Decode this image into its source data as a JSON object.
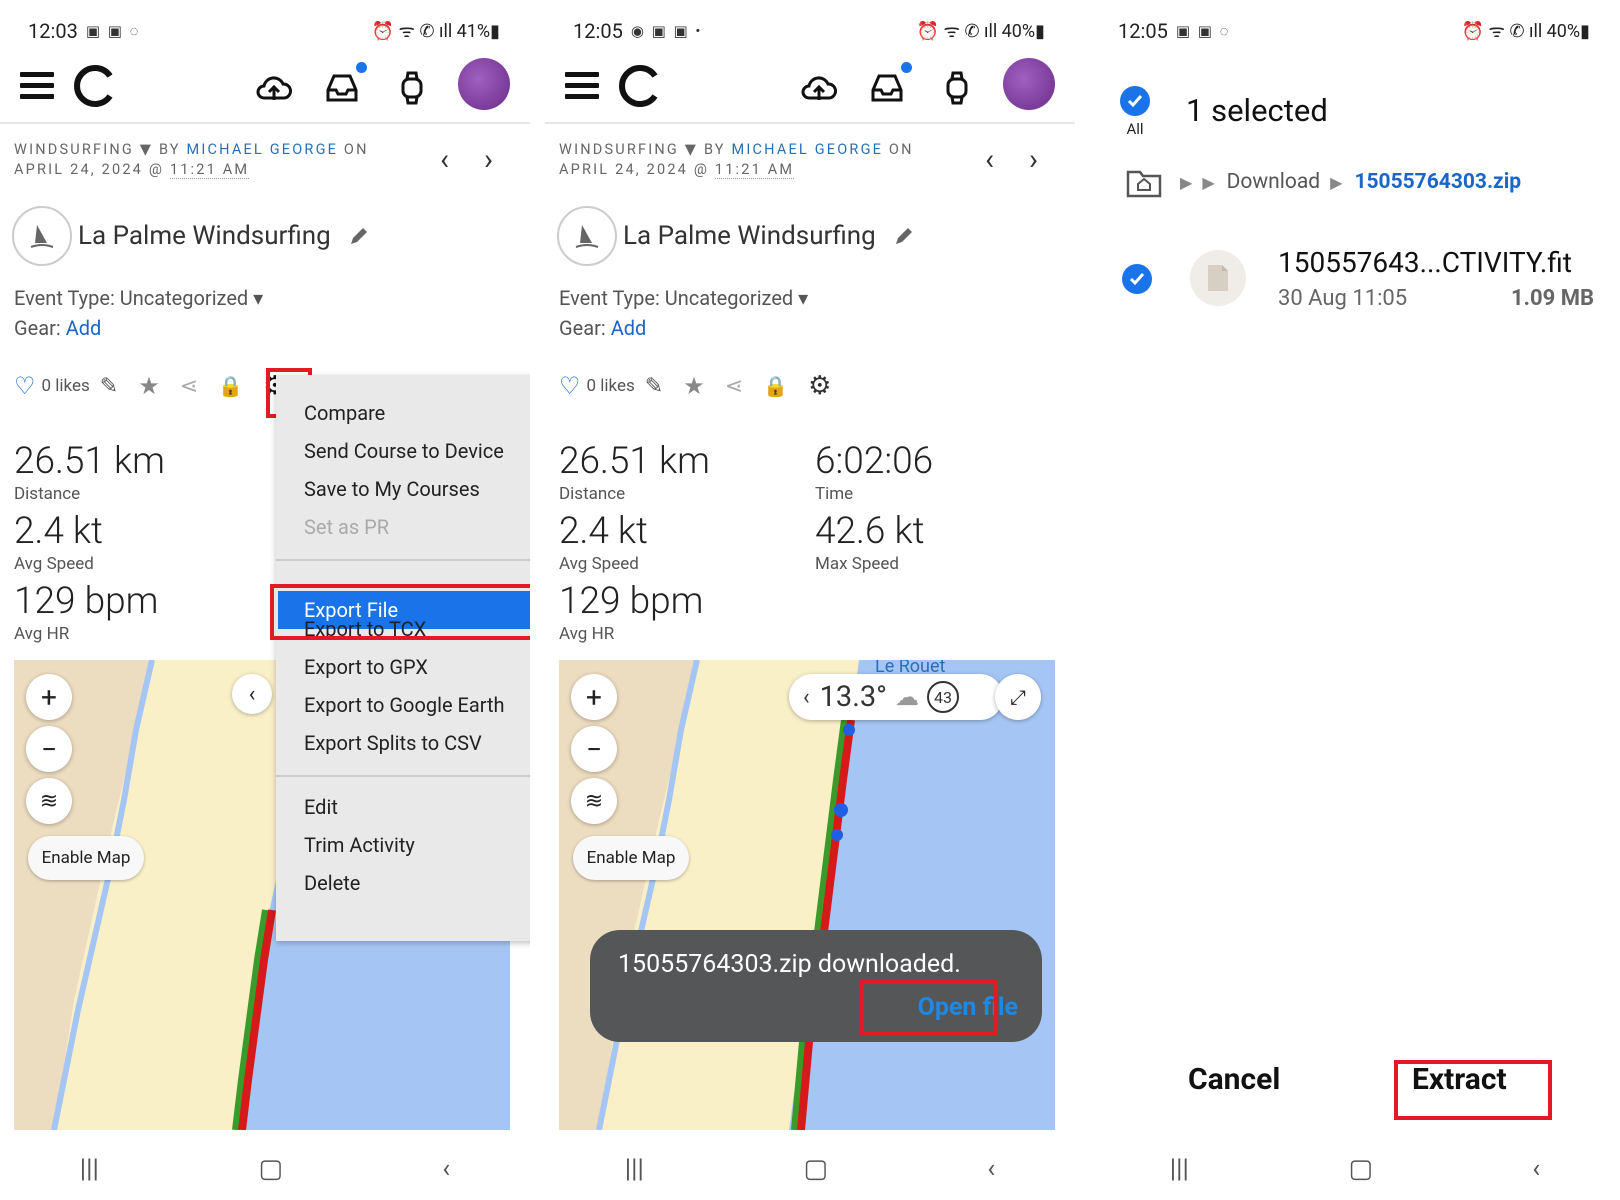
{
  "colors": {
    "accent": "#1a73e8",
    "highlight": "#e01b24",
    "map_water": "#a5c6f5",
    "map_sand": "#faf0c8"
  },
  "panel1": {
    "status": {
      "time": "12:03",
      "battery": "41%"
    },
    "meta": {
      "sport": "WINDSURFING",
      "by": "BY",
      "author": "MICHAEL GEORGE",
      "on": "ON",
      "date": "APRIL 24, 2024 @",
      "time": "11:21 AM"
    },
    "title": "La Palme Windsurfing",
    "event_type": "Event Type: Uncategorized",
    "gear_label": "Gear:",
    "gear_link": "Add",
    "likes": "0 likes",
    "stats": [
      {
        "value": "26.51 km",
        "label": "Distance"
      },
      {
        "value": "2.4 kt",
        "label": "Avg Speed"
      },
      {
        "value": "129 bpm",
        "label": "Avg HR"
      }
    ],
    "menu": {
      "items_a": [
        "Compare",
        "Send Course to Device",
        "Save to My Courses",
        "Set as PR"
      ],
      "selected": "Export File",
      "items_b": [
        "Export to TCX",
        "Export to GPX",
        "Export to Google Earth",
        "Export Splits to CSV"
      ],
      "items_c": [
        "Edit",
        "Trim Activity",
        "Delete"
      ]
    },
    "map": {
      "enable": "Enable Map"
    }
  },
  "panel2": {
    "status": {
      "time": "12:05",
      "battery": "40%"
    },
    "stats": [
      {
        "value": "26.51 km",
        "label": "Distance"
      },
      {
        "value": "6:02:06",
        "label": "Time"
      },
      {
        "value": "2.4 kt",
        "label": "Avg Speed"
      },
      {
        "value": "42.6 kt",
        "label": "Max Speed"
      },
      {
        "value": "129 bpm",
        "label": "Avg HR"
      }
    ],
    "weather": {
      "temp": "13.3°",
      "wind": "43"
    },
    "place": "Le Rouet",
    "toast": {
      "message": "15055764303.zip downloaded.",
      "action": "Open file"
    }
  },
  "panel3": {
    "status": {
      "time": "12:05",
      "battery": "40%"
    },
    "all_label": "All",
    "selected_count": "1 selected",
    "path": {
      "folder": "Download",
      "file": "15055764303.zip"
    },
    "file": {
      "name": "150557643...CTIVITY.fit",
      "date": "30 Aug 11:05",
      "size": "1.09 MB"
    },
    "cancel": "Cancel",
    "extract": "Extract"
  }
}
